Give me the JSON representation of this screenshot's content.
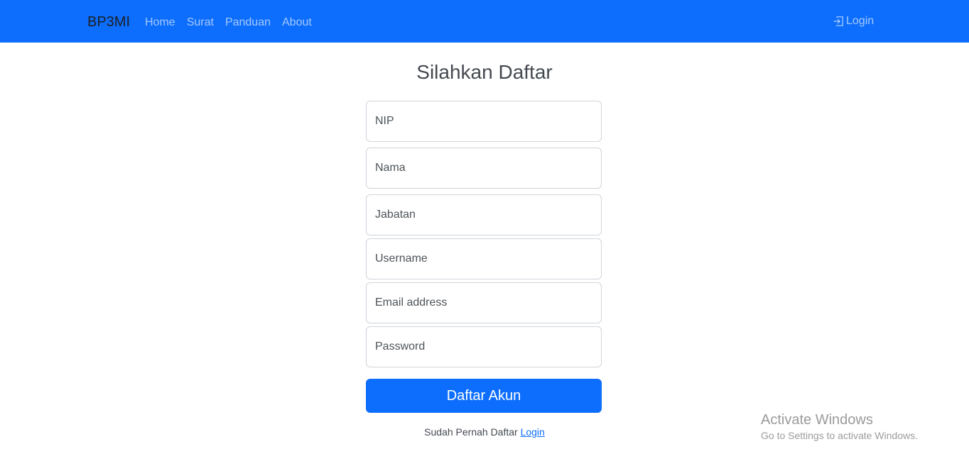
{
  "navbar": {
    "brand": "BP3MI",
    "links": [
      "Home",
      "Surat",
      "Panduan",
      "About"
    ],
    "login_label": "Login",
    "login_icon": "box-arrow-in-right-icon",
    "background_color": "#0d6efd"
  },
  "form": {
    "title": "Silahkan Daftar",
    "fields": [
      {
        "placeholder": "NIP",
        "value": ""
      },
      {
        "placeholder": "Nama",
        "value": ""
      },
      {
        "placeholder": "Jabatan",
        "value": ""
      },
      {
        "placeholder": "Username",
        "value": ""
      },
      {
        "placeholder": "Email address",
        "value": ""
      },
      {
        "placeholder": "Password",
        "value": ""
      }
    ],
    "submit_label": "Daftar Akun",
    "footer_text": "Sudah Pernah Daftar",
    "footer_link": "Login",
    "accent_color": "#0d6efd"
  },
  "watermark": {
    "title": "Activate Windows",
    "subtitle": "Go to Settings to activate Windows."
  }
}
